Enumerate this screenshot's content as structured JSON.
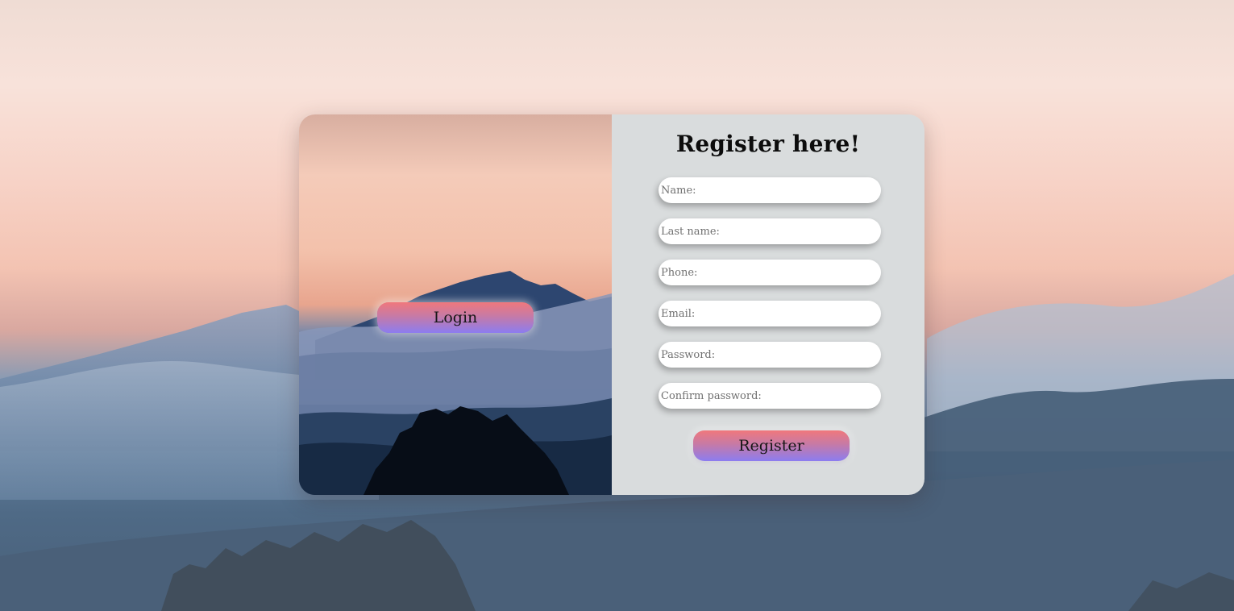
{
  "login_button_label": "Login",
  "form": {
    "title": "Register here!",
    "fields": [
      {
        "placeholder": "Name:",
        "value": ""
      },
      {
        "placeholder": "Last name:",
        "value": ""
      },
      {
        "placeholder": "Phone:",
        "value": ""
      },
      {
        "placeholder": "Email:",
        "value": ""
      },
      {
        "placeholder": "Password:",
        "value": ""
      },
      {
        "placeholder": "Confirm password:",
        "value": ""
      }
    ],
    "submit_label": "Register"
  },
  "colors": {
    "button_gradient_top": "#f0787c",
    "button_gradient_bottom": "#8c7cf0",
    "form_panel_bg": "#d9dcdd"
  }
}
